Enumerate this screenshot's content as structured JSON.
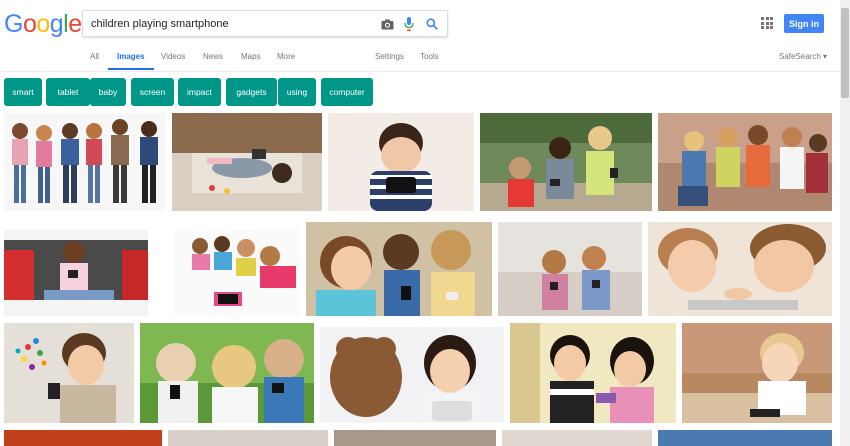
{
  "search": {
    "query": "children playing smartphone"
  },
  "logo": {
    "letters": [
      "G",
      "o",
      "o",
      "g",
      "l",
      "e"
    ],
    "colors": [
      "#4285f4",
      "#ea4335",
      "#fbbc05",
      "#4285f4",
      "#34a853",
      "#ea4335"
    ]
  },
  "header": {
    "signin_label": "Sign in",
    "accent_color": "#4285f4"
  },
  "tabs": {
    "all": "All",
    "images": "Images",
    "videos": "Videos",
    "news": "News",
    "maps": "Maps",
    "more": "More",
    "settings": "Settings",
    "tools": "Tools",
    "safesearch": "SafeSearch ▾"
  },
  "chips": [
    "smart",
    "tablet",
    "baby",
    "screen",
    "impact",
    "gadgets",
    "using",
    "computer"
  ],
  "chip_color": "#009688",
  "icons": {
    "camera": "camera-icon",
    "mic": "microphone-icon",
    "search": "search-icon",
    "apps": "apps-grid-icon"
  }
}
